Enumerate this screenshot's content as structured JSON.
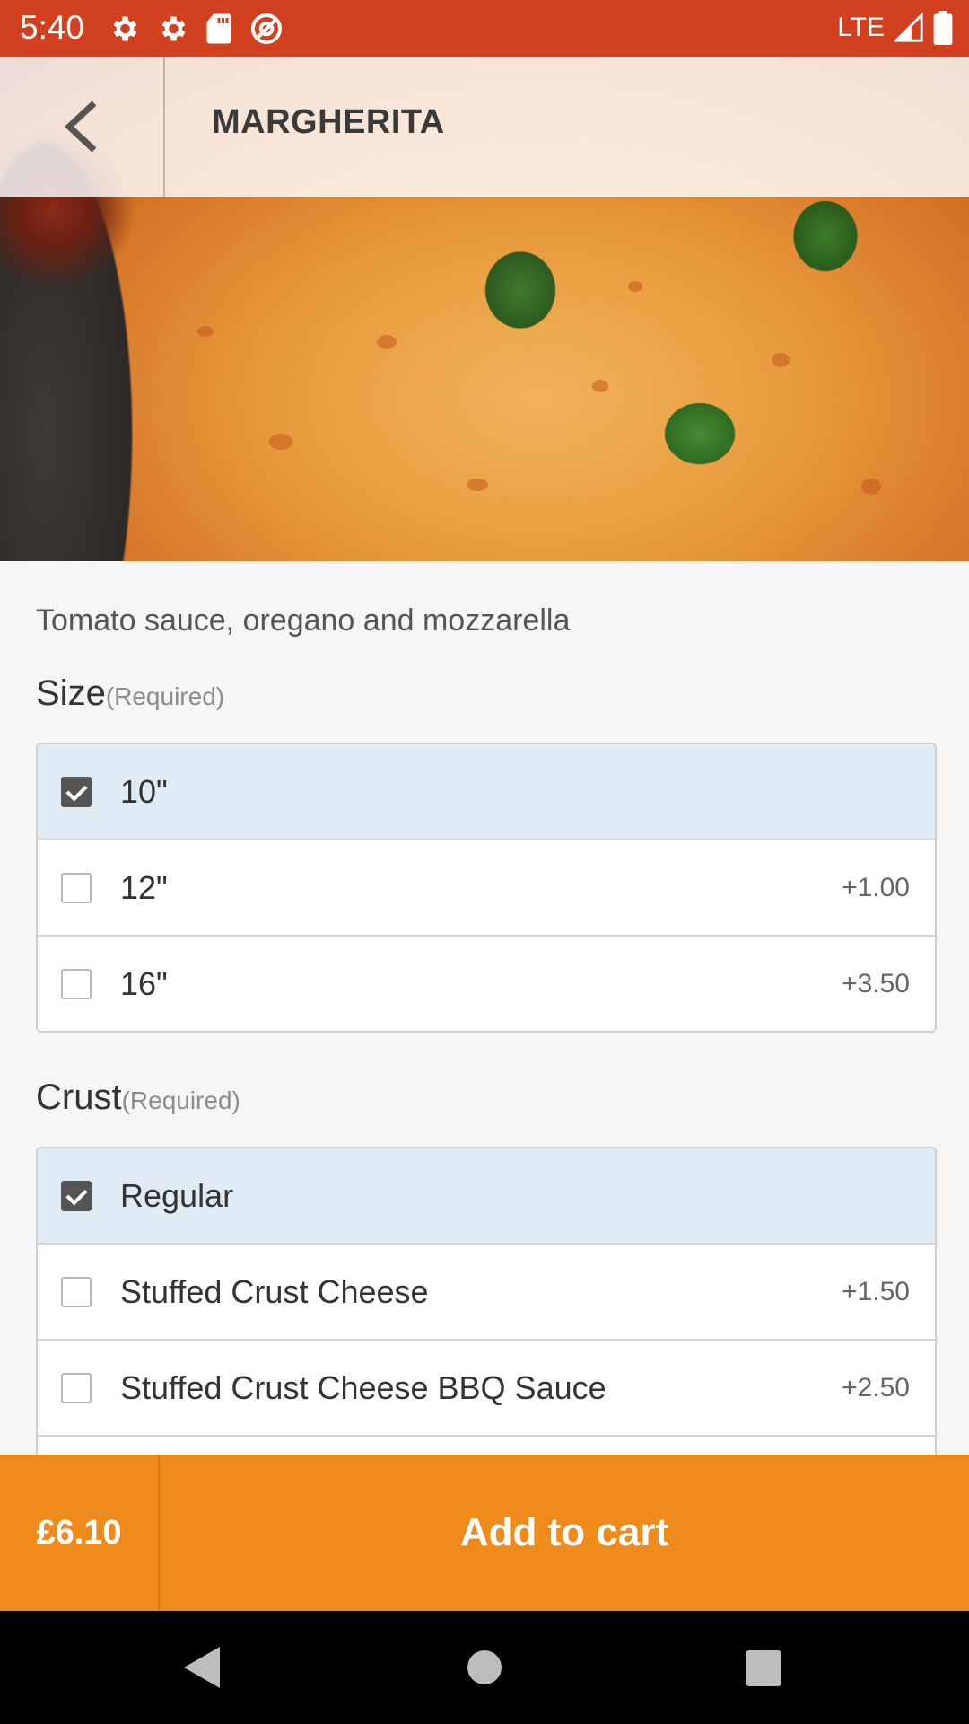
{
  "status_bar": {
    "time": "5:40",
    "network": "LTE",
    "icons": [
      "settings-icon",
      "settings-icon",
      "sd-card-icon",
      "do-not-disturb-icon",
      "signal-icon",
      "battery-icon"
    ]
  },
  "header": {
    "title": "MARGHERITA",
    "back_icon": "chevron-left-icon"
  },
  "description": "Tomato sauce, oregano and mozzarella",
  "sections": [
    {
      "title": "Size",
      "required": "(Required)",
      "options": [
        {
          "label": "10\"",
          "price": "",
          "checked": true
        },
        {
          "label": "12\"",
          "price": "+1.00",
          "checked": false
        },
        {
          "label": "16\"",
          "price": "+3.50",
          "checked": false
        }
      ]
    },
    {
      "title": "Crust",
      "required": "(Required)",
      "options": [
        {
          "label": "Regular",
          "price": "",
          "checked": true
        },
        {
          "label": "Stuffed Crust Cheese",
          "price": "+1.50",
          "checked": false
        },
        {
          "label": "Stuffed Crust Cheese BBQ Sauce",
          "price": "+2.50",
          "checked": false
        }
      ]
    }
  ],
  "action_bar": {
    "total": "£6.10",
    "add_label": "Add to cart"
  },
  "colors": {
    "status_bar": "#d2401f",
    "action_bar": "#ef8b1a",
    "selected_row": "#e0ecf5"
  }
}
